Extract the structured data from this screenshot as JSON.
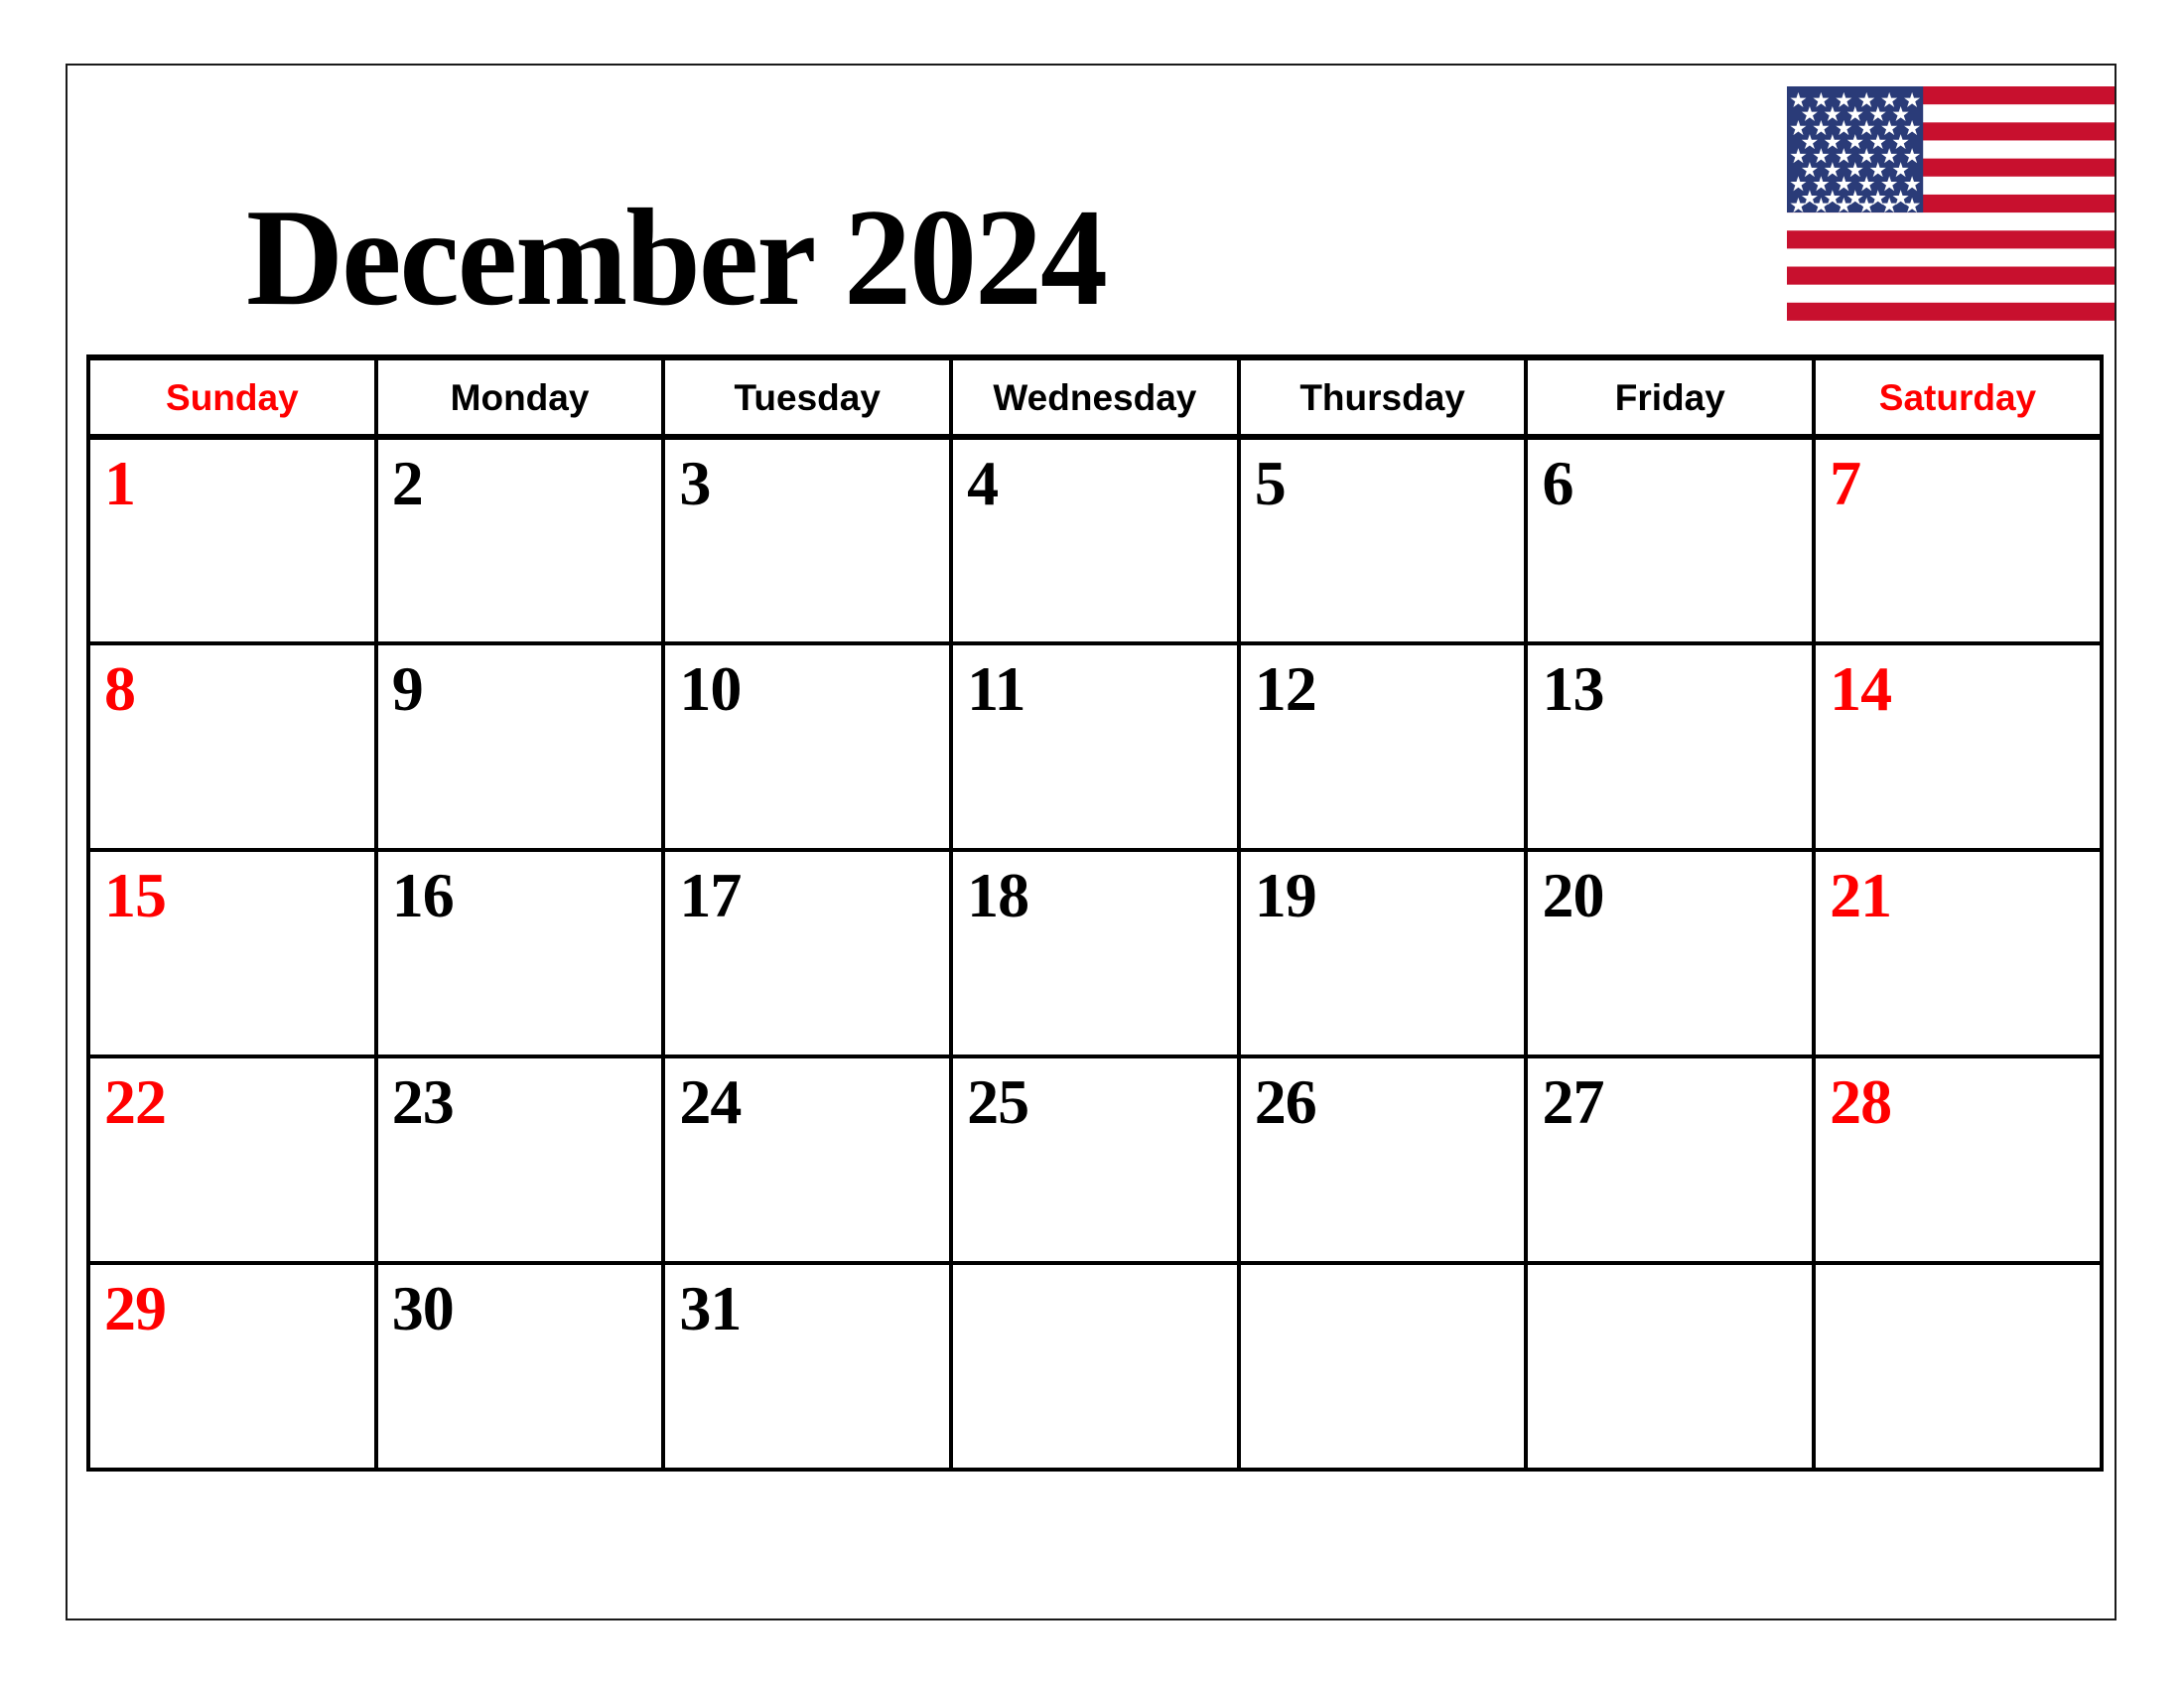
{
  "document": {
    "title": "December 2024",
    "month_name": "December",
    "year": "2024"
  },
  "flag": {
    "name": "united-states-flag",
    "stars_count": 50,
    "stripes_count": 13,
    "colors": {
      "red": "#c8102e",
      "white": "#ffffff",
      "blue": "#2a3b78"
    }
  },
  "colors": {
    "weekend_text": "#ff0000",
    "weekday_text": "#000000",
    "grid_line": "#000000",
    "page_background": "#ffffff",
    "page_border": "#1a1a1a"
  },
  "calendar": {
    "weekday_headers": [
      {
        "label": "Sunday",
        "weekend": true
      },
      {
        "label": "Monday",
        "weekend": false
      },
      {
        "label": "Tuesday",
        "weekend": false
      },
      {
        "label": "Wednesday",
        "weekend": false
      },
      {
        "label": "Thursday",
        "weekend": false
      },
      {
        "label": "Friday",
        "weekend": false
      },
      {
        "label": "Saturday",
        "weekend": true
      }
    ],
    "weeks": [
      {
        "days": [
          {
            "num": "1",
            "weekend": true,
            "empty": false
          },
          {
            "num": "2",
            "weekend": false,
            "empty": false
          },
          {
            "num": "3",
            "weekend": false,
            "empty": false
          },
          {
            "num": "4",
            "weekend": false,
            "empty": false
          },
          {
            "num": "5",
            "weekend": false,
            "empty": false
          },
          {
            "num": "6",
            "weekend": false,
            "empty": false
          },
          {
            "num": "7",
            "weekend": true,
            "empty": false
          }
        ]
      },
      {
        "days": [
          {
            "num": "8",
            "weekend": true,
            "empty": false
          },
          {
            "num": "9",
            "weekend": false,
            "empty": false
          },
          {
            "num": "10",
            "weekend": false,
            "empty": false
          },
          {
            "num": "11",
            "weekend": false,
            "empty": false
          },
          {
            "num": "12",
            "weekend": false,
            "empty": false
          },
          {
            "num": "13",
            "weekend": false,
            "empty": false
          },
          {
            "num": "14",
            "weekend": true,
            "empty": false
          }
        ]
      },
      {
        "days": [
          {
            "num": "15",
            "weekend": true,
            "empty": false
          },
          {
            "num": "16",
            "weekend": false,
            "empty": false
          },
          {
            "num": "17",
            "weekend": false,
            "empty": false
          },
          {
            "num": "18",
            "weekend": false,
            "empty": false
          },
          {
            "num": "19",
            "weekend": false,
            "empty": false
          },
          {
            "num": "20",
            "weekend": false,
            "empty": false
          },
          {
            "num": "21",
            "weekend": true,
            "empty": false
          }
        ]
      },
      {
        "days": [
          {
            "num": "22",
            "weekend": true,
            "empty": false
          },
          {
            "num": "23",
            "weekend": false,
            "empty": false
          },
          {
            "num": "24",
            "weekend": false,
            "empty": false
          },
          {
            "num": "25",
            "weekend": false,
            "empty": false
          },
          {
            "num": "26",
            "weekend": false,
            "empty": false
          },
          {
            "num": "27",
            "weekend": false,
            "empty": false
          },
          {
            "num": "28",
            "weekend": true,
            "empty": false
          }
        ]
      },
      {
        "days": [
          {
            "num": "29",
            "weekend": true,
            "empty": false
          },
          {
            "num": "30",
            "weekend": false,
            "empty": false
          },
          {
            "num": "31",
            "weekend": false,
            "empty": false
          },
          {
            "num": "",
            "weekend": false,
            "empty": true
          },
          {
            "num": "",
            "weekend": false,
            "empty": true
          },
          {
            "num": "",
            "weekend": false,
            "empty": true
          },
          {
            "num": "",
            "weekend": true,
            "empty": true
          }
        ]
      }
    ]
  }
}
